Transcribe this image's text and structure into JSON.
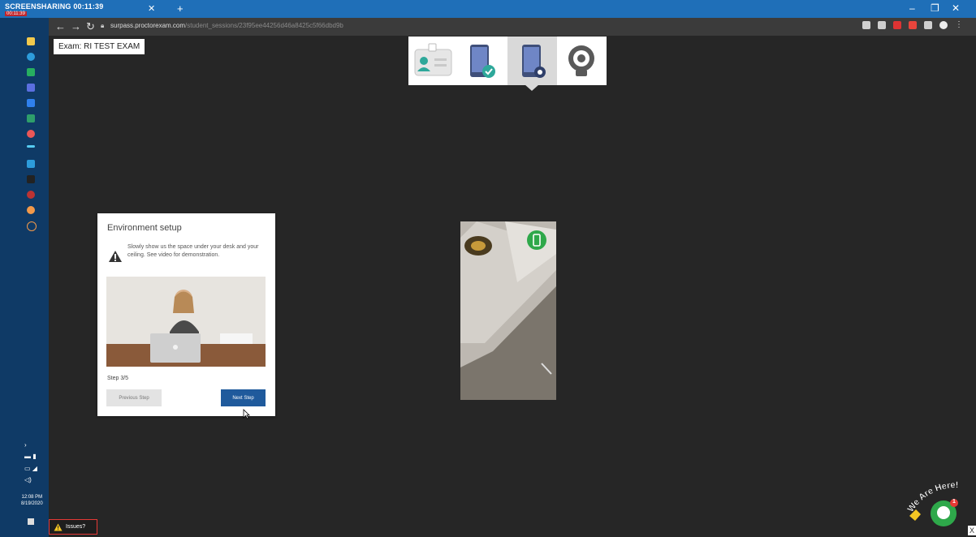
{
  "recording": {
    "label": "SCREENSHARING",
    "status": "00:11:39",
    "timer": "00:11:39"
  },
  "browser": {
    "url_host": "surpass.proctorexam.com",
    "url_path": "/student_sessions/23f95ee44256d46a8425c5f66dbd9b"
  },
  "exam": {
    "label": "Exam: RI TEST EXAM"
  },
  "steps": [
    {
      "name": "id-card-icon",
      "active": false
    },
    {
      "name": "phone-check-icon",
      "active": false
    },
    {
      "name": "phone-camera-icon",
      "active": true
    },
    {
      "name": "webcam-icon",
      "active": false
    }
  ],
  "modal": {
    "title": "Environment setup",
    "instructions": "Slowly show us the space under your desk and your ceiling. See video for demonstration.",
    "step_label": "Step 3/5",
    "prev_label": "Previous Step",
    "next_label": "Next Step"
  },
  "taskbar": {
    "time": "12:08 PM",
    "date": "8/19/2020"
  },
  "issues": {
    "label": "Issues?"
  },
  "chat": {
    "label": "We Are Here!",
    "badge": "1"
  },
  "close": {
    "label": "X"
  },
  "colors": {
    "accent": "#1f5a9c",
    "teal": "#2ea89a",
    "warning": "#f3c623"
  }
}
